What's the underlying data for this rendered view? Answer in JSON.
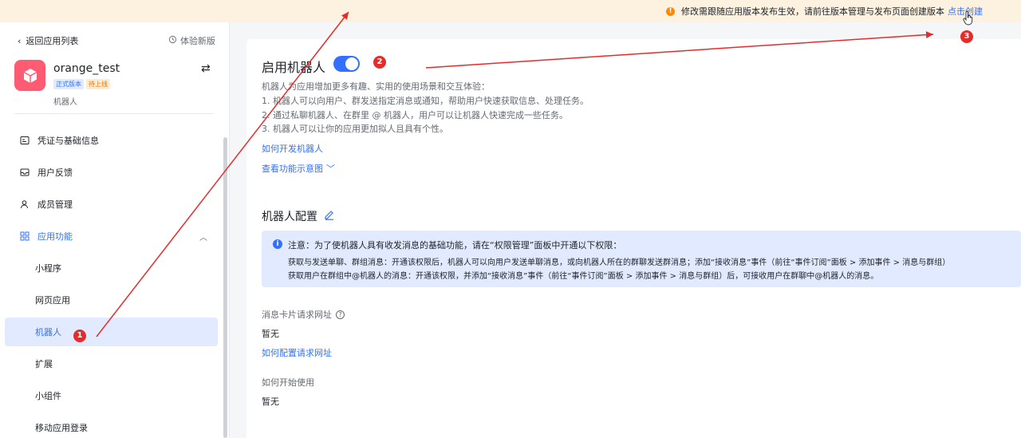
{
  "banner": {
    "text": "修改需跟随应用版本发布生效，请前往版本管理与发布页面创建版本",
    "link": "点击创建"
  },
  "sidebar": {
    "back_label": "返回应用列表",
    "experience_label": "体验新版",
    "app_name": "orange_test",
    "badge_release": "正式版本",
    "badge_pending": "待上线",
    "app_subtitle": "机器人",
    "items": [
      {
        "label": "凭证与基础信息",
        "icon": "id-card-icon"
      },
      {
        "label": "用户反馈",
        "icon": "inbox-icon"
      },
      {
        "label": "成员管理",
        "icon": "user-icon"
      },
      {
        "label": "应用功能",
        "icon": "grid-icon"
      },
      {
        "label": "小程序"
      },
      {
        "label": "网页应用"
      },
      {
        "label": "机器人"
      },
      {
        "label": "扩展"
      },
      {
        "label": "小组件"
      },
      {
        "label": "移动应用登录"
      }
    ]
  },
  "main": {
    "title": "启用机器人",
    "toggle_on": true,
    "desc_intro": "机器人为应用增加更多有趣、实用的使用场景和交互体验：",
    "desc_1": "1. 机器人可以向用户、群发送指定消息或通知，帮助用户快速获取信息、处理任务。",
    "desc_2": "2. 通过私聊机器人、在群里 @ 机器人，用户可以让机器人快速完成一些任务。",
    "desc_3": "3. 机器人可以让你的应用更加拟人且具有个性。",
    "link_dev": "如何开发机器人",
    "link_demo": "查看功能示意图",
    "config_title": "机器人配置",
    "notice_title": "注意：为了使机器人具有收发消息的基础功能，请在“权限管理”面板中开通以下权限：",
    "notice_line1": "获取与发送单聊、群组消息：开通该权限后，机器人可以向用户发送单聊消息，或向机器人所在的群聊发送群消息；添加“接收消息”事件（前往“事件订阅”面板 > 添加事件 > 消息与群组）",
    "notice_line2": "获取用户在群组中@机器人的消息：开通该权限，并添加“接收消息”事件（前往“事件订阅”面板 > 添加事件 > 消息与群组）后，可接收用户在群聊中@机器人的消息。",
    "card_url_label": "消息卡片请求网址",
    "card_url_value": "暂无",
    "card_url_link": "如何配置请求网址",
    "start_label": "如何开始使用",
    "start_value": "暂无"
  },
  "markers": [
    "1",
    "2",
    "3"
  ],
  "colors": {
    "accent": "#3370ff",
    "marker": "#e52c2c",
    "banner_bg": "#fdf1df"
  }
}
